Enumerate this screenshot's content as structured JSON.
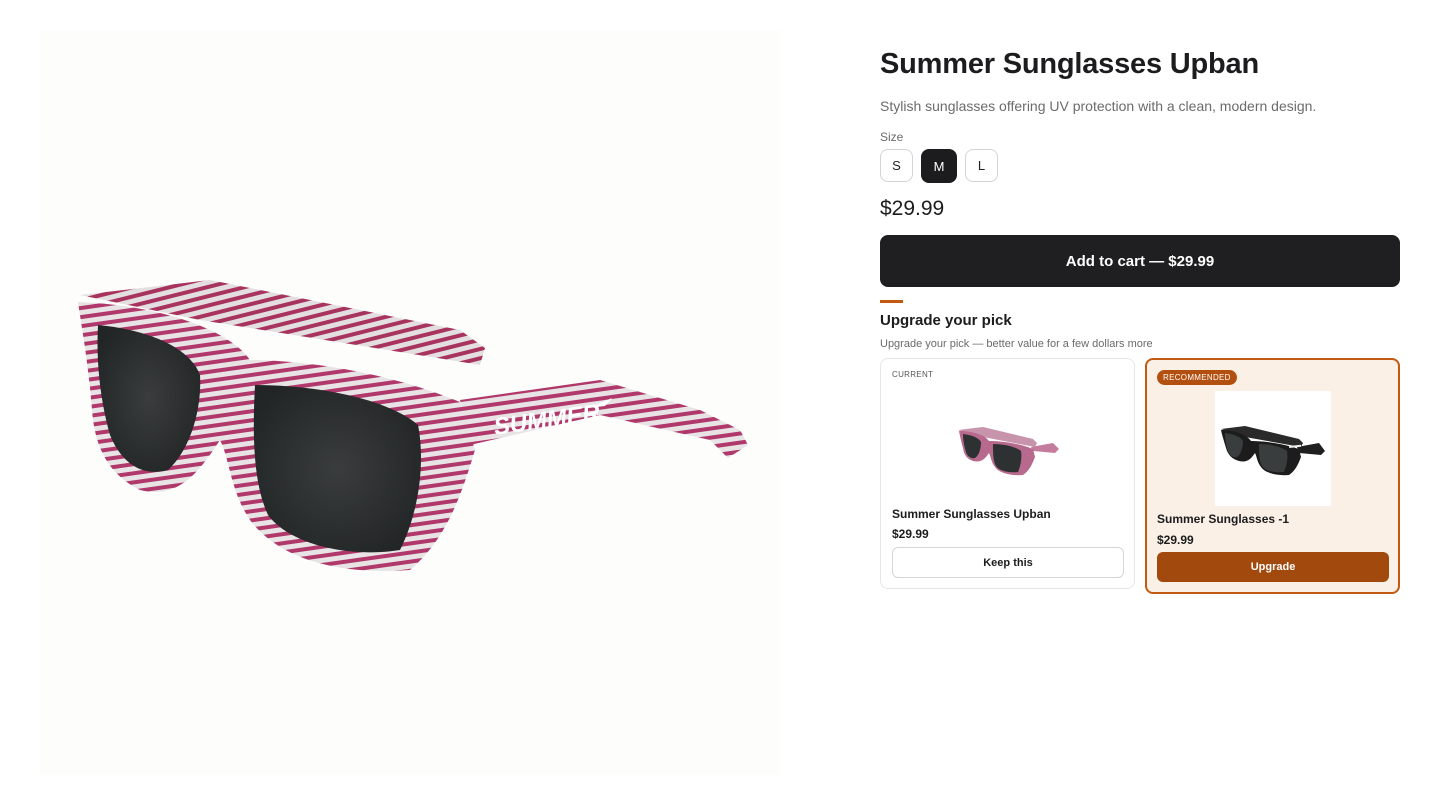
{
  "product": {
    "title": "Summer Sunglasses Upban",
    "description": "Stylish sunglasses offering UV protection with a clean, modern design.",
    "size_label": "Size",
    "sizes": [
      "S",
      "M",
      "L"
    ],
    "selected_size": "M",
    "price": "$29.99",
    "add_to_cart_label": "Add to cart — $29.99",
    "image_icon": "striped-sunglasses-image",
    "temple_print": "SUMMER"
  },
  "upgrade": {
    "title": "Upgrade your pick",
    "subtitle": "Upgrade your pick — better value for a few dollars more",
    "current": {
      "tag": "CURRENT",
      "name": "Summer Sunglasses Upban",
      "price": "$29.99",
      "button_label": "Keep this"
    },
    "recommended": {
      "tag": "RECOMMENDED",
      "name": "Summer Sunglasses -1",
      "price": "$29.99",
      "button_label": "Upgrade"
    }
  },
  "colors": {
    "accent": "#c25a14",
    "primary_button": "#1f1f21",
    "recommended_bg": "#fbf0e6",
    "frame_stripe": "#b0386a"
  }
}
